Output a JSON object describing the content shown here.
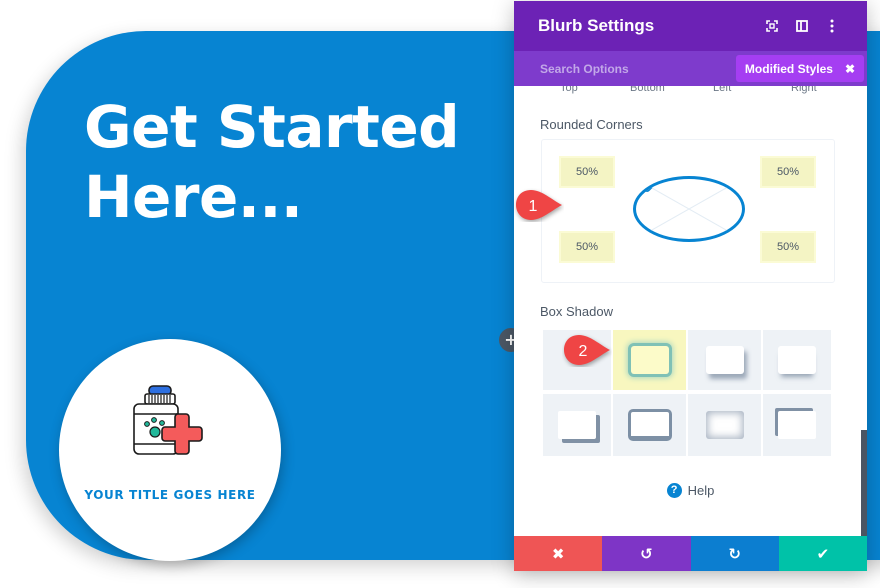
{
  "canvas": {
    "headline_line1": "Get Started",
    "headline_line2": "Here...",
    "blurb_title": "YOUR TITLE GOES HERE",
    "blurb_icon": "pet-medicine-bottle-icon",
    "add_button_label": "+",
    "section_color": "#0784d2"
  },
  "panel": {
    "title": "Blurb Settings",
    "header_icons": [
      "expand-icon",
      "split-view-icon",
      "more-options-icon"
    ],
    "search_placeholder": "Search Options",
    "modified_styles_label": "Modified Styles",
    "modified_styles_close": "✖",
    "side_labels": [
      "Top",
      "Bottom",
      "Left",
      "Right"
    ],
    "rounded_corners": {
      "label": "Rounded Corners",
      "top_left": "50%",
      "top_right": "50%",
      "bottom_left": "50%",
      "bottom_right": "50%",
      "linked": true
    },
    "box_shadow": {
      "label": "Box Shadow",
      "options": [
        "none",
        "glow",
        "bottom-right-soft",
        "bottom-soft",
        "bottom-left-offset",
        "outline-bottom",
        "inset",
        "top-left-offset"
      ],
      "selected_index": 1
    },
    "help_label": "Help",
    "footer": {
      "cancel": "✖",
      "undo": "↺",
      "redo": "↻",
      "save": "✔"
    },
    "colors": {
      "header": "#6c22b5",
      "subheader": "#7e3bcc",
      "modified_button": "#a53ef2",
      "cancel": "#ef5555",
      "undo": "#7e35c6",
      "redo": "#0c7ed0",
      "save": "#00c2a8"
    }
  },
  "callouts": [
    "1",
    "2"
  ]
}
